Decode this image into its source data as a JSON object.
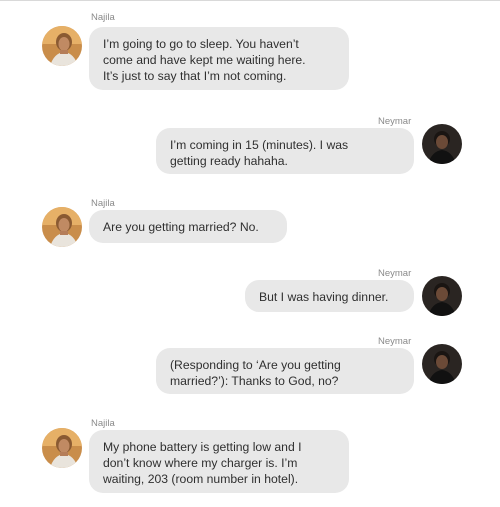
{
  "messages": [
    {
      "sender": "Najila",
      "side": "left",
      "lines": [
        "I’m going to go to sleep. You haven’t",
        "come and have kept me waiting here.",
        "It’s just to say that I’m not coming."
      ]
    },
    {
      "sender": "Neymar",
      "side": "right",
      "lines": [
        "I’m coming in 15 (minutes). I was",
        "getting ready hahaha."
      ]
    },
    {
      "sender": "Najila",
      "side": "left",
      "lines": [
        "Are you getting married? No."
      ]
    },
    {
      "sender": "Neymar",
      "side": "right",
      "lines": [
        "But I was having dinner."
      ]
    },
    {
      "sender": "Neymar",
      "side": "right",
      "lines": [
        "(Responding to ‘Are you getting",
        "married?’): Thanks to God, no?"
      ]
    },
    {
      "sender": "Najila",
      "side": "left",
      "lines": [
        "My phone battery is getting low and I",
        "don’t know where my charger is. I’m",
        "waiting, 203 (room number in hotel)."
      ]
    }
  ],
  "avatar_icons": {
    "Najila": "female-avatar-icon",
    "Neymar": "male-avatar-icon"
  },
  "colors": {
    "bubble": "#e8e8e8",
    "sender_label": "#8a8a8a",
    "text": "#2f2f2f"
  }
}
